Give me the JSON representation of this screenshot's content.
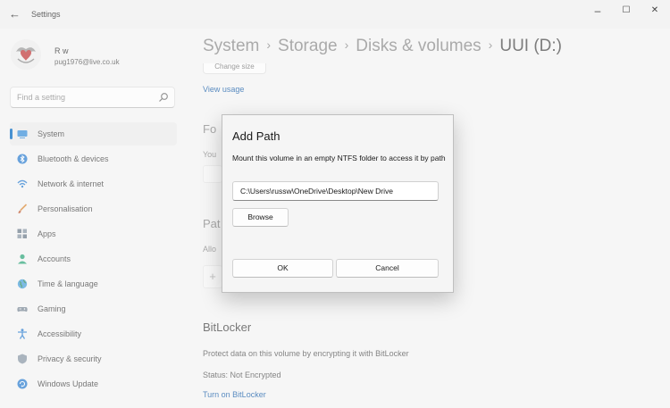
{
  "window": {
    "app_title": "Settings",
    "back_glyph": "←",
    "minimize_glyph": "–",
    "maximize_glyph": "☐",
    "close_glyph": "✕"
  },
  "user": {
    "name": "R w",
    "email": "pug1976@live.co.uk"
  },
  "search": {
    "placeholder": "Find a setting"
  },
  "sidebar": {
    "items": [
      {
        "label": "System",
        "icon": "system-icon",
        "active": true
      },
      {
        "label": "Bluetooth & devices",
        "icon": "bluetooth-icon"
      },
      {
        "label": "Network & internet",
        "icon": "network-icon"
      },
      {
        "label": "Personalisation",
        "icon": "brush-icon"
      },
      {
        "label": "Apps",
        "icon": "apps-icon"
      },
      {
        "label": "Accounts",
        "icon": "person-icon"
      },
      {
        "label": "Time & language",
        "icon": "globe-icon"
      },
      {
        "label": "Gaming",
        "icon": "gamepad-icon"
      },
      {
        "label": "Accessibility",
        "icon": "accessibility-icon"
      },
      {
        "label": "Privacy & security",
        "icon": "shield-icon"
      },
      {
        "label": "Windows Update",
        "icon": "update-icon"
      }
    ]
  },
  "breadcrumb": {
    "items": [
      "System",
      "Storage",
      "Disks & volumes"
    ],
    "current": "UUI (D:)",
    "separator": "›"
  },
  "main": {
    "change_size": "Change size",
    "view_usage": "View usage",
    "format_heading_partial": "Fo",
    "format_text_partial": "You",
    "paths_heading_partial": "Pat",
    "paths_text_partial": "Allo",
    "add_glyph": "+",
    "bitlocker": {
      "heading": "BitLocker",
      "description": "Protect data on this volume by encrypting it with BitLocker",
      "status": "Status: Not Encrypted",
      "link": "Turn on BitLocker"
    }
  },
  "dialog": {
    "title": "Add Path",
    "description": "Mount this volume in an empty NTFS folder to access it by path",
    "path_value": "C:\\Users\\russw\\OneDrive\\Desktop\\New Drive",
    "browse_label": "Browse",
    "ok_label": "OK",
    "cancel_label": "Cancel"
  },
  "colors": {
    "accent": "#0067c0",
    "link": "#1a5fa8",
    "background": "#f3f3f3"
  }
}
